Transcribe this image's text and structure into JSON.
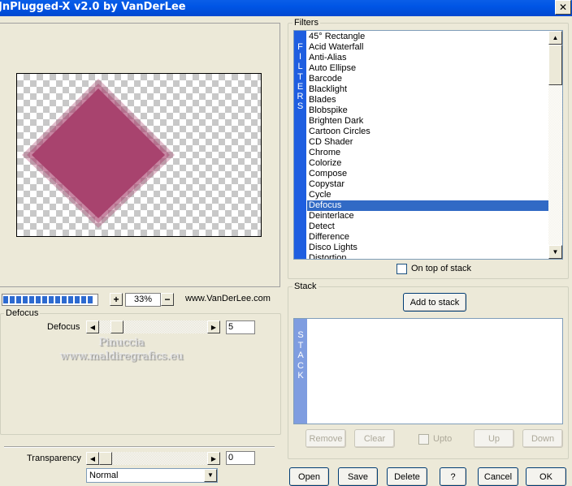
{
  "window": {
    "title": "JnPlugged-X v2.0 by VanDerLee",
    "close_glyph": "✕"
  },
  "preview": {
    "shape_color": "#a8436e"
  },
  "progress": {
    "fill": 1.0
  },
  "zoom": {
    "minus": "−",
    "plus": "+",
    "value": "33%"
  },
  "site": "www.VanDerLee.com",
  "defocus": {
    "group_label": "Defocus",
    "slider_label": "Defocus",
    "value": "5"
  },
  "watermark": {
    "line1": "Pinuccia",
    "line2": "www.maldiregrafics.eu"
  },
  "filters": {
    "group_label": "Filters",
    "strip_letters": [
      "F",
      "I",
      "L",
      "T",
      "E",
      "R",
      "S"
    ],
    "items": [
      "45° Rectangle",
      "Acid Waterfall",
      "Anti-Alias",
      "Auto Ellipse",
      "Barcode",
      "Blacklight",
      "Blades",
      "Blobspike",
      "Brighten Dark",
      "Cartoon Circles",
      "CD Shader",
      "Chrome",
      "Colorize",
      "Compose",
      "Copystar",
      "Cycle",
      "Defocus",
      "Deinterlace",
      "Detect",
      "Difference",
      "Disco Lights",
      "Distortion"
    ],
    "selected": "Defocus",
    "on_top_label": "On top of stack"
  },
  "stack": {
    "group_label": "Stack",
    "add_label": "Add to stack",
    "strip_letters": [
      "S",
      "T",
      "A",
      "C",
      "K"
    ],
    "remove_label": "Remove",
    "clear_label": "Clear",
    "upto_label": "Upto",
    "up_label": "Up",
    "down_label": "Down"
  },
  "transparency": {
    "label": "Transparency",
    "value": "0",
    "blend_mode": "Normal"
  },
  "buttons": {
    "open": "Open",
    "save": "Save",
    "delete": "Delete",
    "help": "?",
    "cancel": "Cancel",
    "ok": "OK"
  },
  "colors": {
    "titlebar": "#0055e5",
    "filters_strip": "#1e5ee0",
    "stack_strip": "#7f9de0",
    "selection": "#316ac5"
  }
}
